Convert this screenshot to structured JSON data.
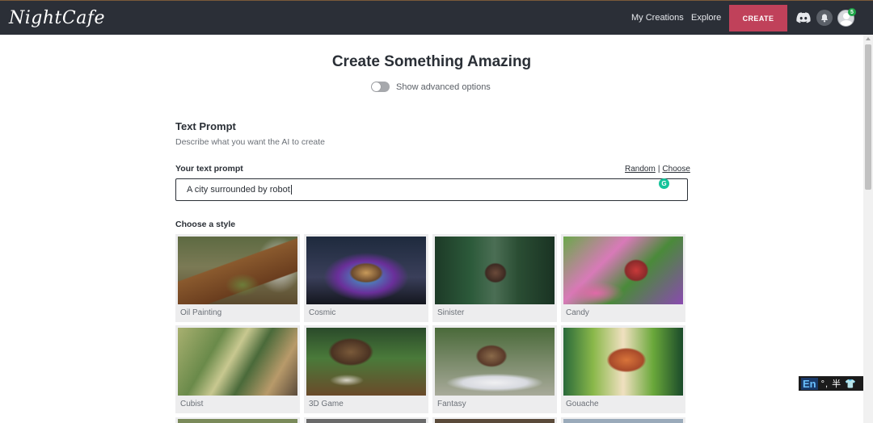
{
  "header": {
    "logo": "NightCafe",
    "nav": [
      {
        "label": "My Creations"
      },
      {
        "label": "Explore"
      }
    ],
    "create_label": "CREATE",
    "notification_count": "5"
  },
  "main": {
    "title": "Create Something Amazing",
    "advanced_toggle_label": "Show advanced options",
    "text_prompt_section": {
      "title": "Text Prompt",
      "description": "Describe what you want the AI to create",
      "prompt_label": "Your text prompt",
      "random_link": "Random",
      "separator": "|",
      "choose_link": "Choose",
      "prompt_value": "A city surrounded by robot"
    },
    "style_section": {
      "label": "Choose a style",
      "styles": [
        {
          "name": "Oil Painting"
        },
        {
          "name": "Cosmic"
        },
        {
          "name": "Sinister"
        },
        {
          "name": "Candy"
        },
        {
          "name": "Cubist"
        },
        {
          "name": "3D Game"
        },
        {
          "name": "Fantasy"
        },
        {
          "name": "Gouache"
        }
      ]
    }
  },
  "ime": {
    "lang": "En",
    "symbols": "°, 半 👕"
  },
  "colors": {
    "topbar": "#2b2f37",
    "create_button": "#c0415a",
    "badge": "#1ea548",
    "grammarly": "#15c39a"
  }
}
